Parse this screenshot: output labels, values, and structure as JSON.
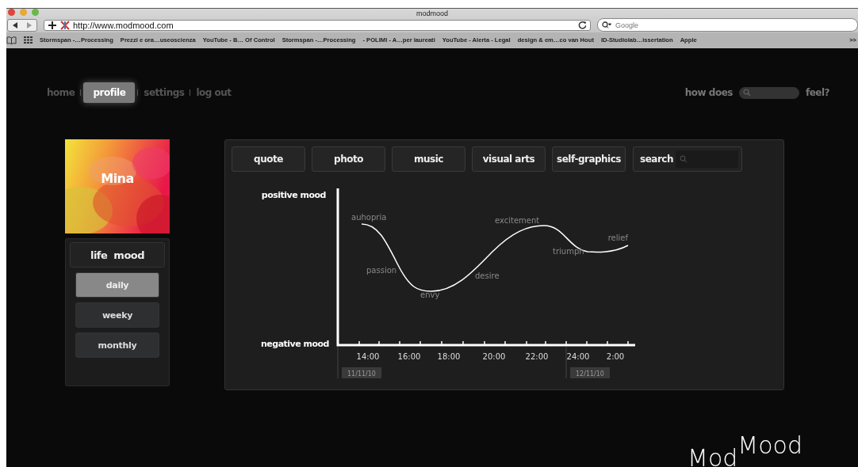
{
  "browser": {
    "title": "modmood",
    "url": "http://www.modmood.com",
    "search": {
      "placeholder": "Google"
    },
    "bookmarks": [
      "Stormspan -…Processing",
      "Prezzi e ora…useoscienza",
      "YouTube - B… Of Control",
      "Stormspan -…Processing",
      "- POLIMI - A…per laureati",
      "YouTube - Alerta - Legal",
      "design & em…co van Hout",
      "ID-Studiolab…issertation",
      "Apple"
    ],
    "more": ">>"
  },
  "nav": [
    {
      "label": "home",
      "selected": false
    },
    {
      "label": "profile",
      "selected": true
    },
    {
      "label": "settings",
      "selected": false
    },
    {
      "label": "log out",
      "selected": false
    }
  ],
  "question": {
    "prefix": "how does",
    "suffix": "feel?"
  },
  "profile": {
    "name": "Mina",
    "mood_title": "life  mood",
    "periods": [
      {
        "label": "daily",
        "selected": true
      },
      {
        "label": "weeky",
        "selected": false
      },
      {
        "label": "monthly",
        "selected": false
      }
    ]
  },
  "tabs": [
    {
      "label": "quote"
    },
    {
      "label": "photo"
    },
    {
      "label": "music"
    },
    {
      "label": "visual arts"
    },
    {
      "label": "self-graphics"
    }
  ],
  "search": {
    "label": "search"
  },
  "chart": {
    "top_label": "positive mood",
    "bottom_label": "negative mood",
    "times": [
      "14:00",
      "16:00",
      "18:00",
      "20:00",
      "22:00",
      "24:00",
      "2:00"
    ],
    "dates": [
      "11/11/10",
      "12/11/10"
    ],
    "moods": [
      "auhopria",
      "passion",
      "envy",
      "desire",
      "excitement",
      "triumph",
      "relief"
    ]
  },
  "logo": {
    "low": "Mod",
    "high": "Mood"
  }
}
